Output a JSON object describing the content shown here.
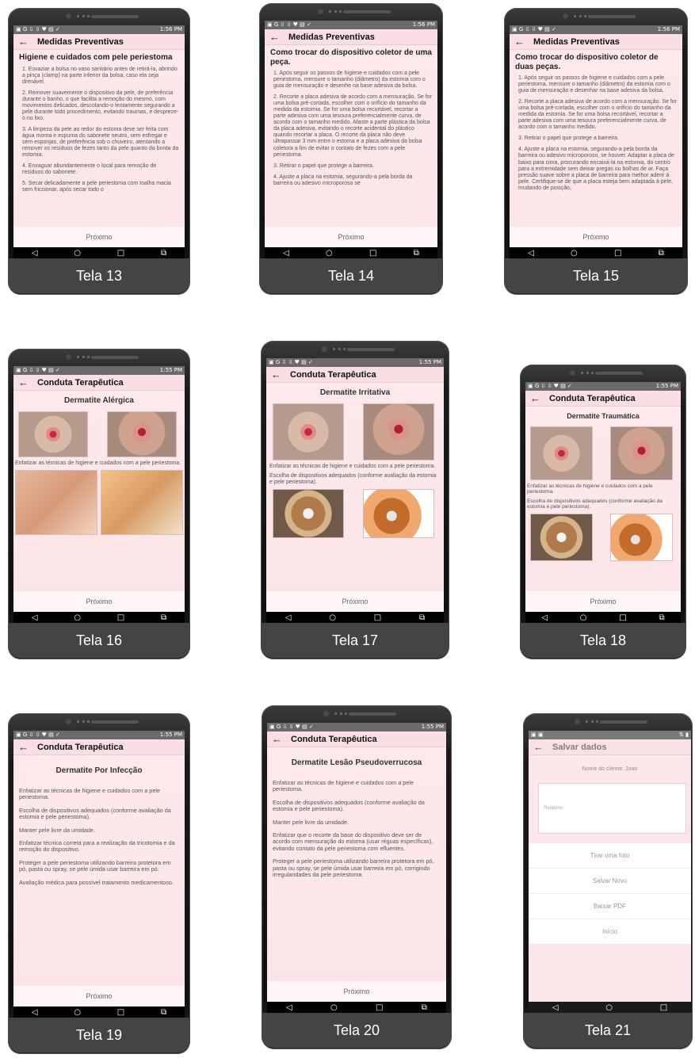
{
  "status": {
    "time": "1:56 PM"
  },
  "status_b": {
    "time": "1:55 PM"
  },
  "common": {
    "back_arrow": "←",
    "next_label": "Próximo",
    "nav_back": "◁",
    "nav_home": "○",
    "nav_recent": "□",
    "nav_dual": "⧉"
  },
  "icons": [
    "back-arrow-icon",
    "nav-back-icon",
    "nav-home-icon",
    "nav-recent-icon",
    "dual-window-icon"
  ],
  "screens": [
    {
      "tela_label": "Tela 13",
      "title": "Medidas Preventivas",
      "heading": "Higiene e cuidados com pele periestoma",
      "paragraphs": [
        "1. Esvaziar a bolsa no vaso sanitário antes de retirá-la, abrindo a pinça (clamp) na parte inferior da bolsa, caso ela seja drenável.",
        "2. Remover suavemente o dispositivo da pele, de preferência durante o banho, o que facilita a remoção do mesmo, com movimentos delicados, descolando-o lentamente segurando a pele durante todo procedimento, evitando traumas, e despreze-o no lixo.",
        "3. A limpeza da pele ao redor do estoma deve ser feita com água morna e espuma do sabonete neutro, sem esfregar e sem esponjas, de preferência sob o chuveiro, atentando a remover os resíduos de fezes tanto da pele quanto da borda da estomia.",
        "4. Enxaguar abundantemente o local para remoção de resíduos do sabonete.",
        "5. Secar delicadamente a pele periestoma com toalha macia sem friccionar, após secar todo o"
      ]
    },
    {
      "tela_label": "Tela 14",
      "title": "Medidas Preventivas",
      "heading": "Como trocar do dispositivo coletor de uma peça.",
      "paragraphs": [
        "1. Após seguir os passos de higiene e cuidados com a pele periestoma, mensure o tamanho (diâmetro) da estomia com o guia de mensuração e desenhe na base adesiva da bolsa.",
        "2. Recorte a placa adesiva de acordo com a mensuração. Se for uma bolsa pré-cortada, escolher com o orifício do tamanho da medida da estomia. Se for uma bolsa recortável, recortar a parte adesiva com uma tesoura preferencialmente curva, de acordo com o tamanho medido. Afaste a parte plástica da bolsa da placa adesiva, evitando o recorte acidental do plástico quando recortar a placa. O recorte da placa não deve ultrapassar 3 mm entre o estoma e a placa adesiva da bolsa coletora a fim de evitar o contato de fezes com a pele periestoma.",
        "3. Retirar o papel que protege a barreira.",
        "4. Ajuste a placa na estomia, segurando-a pela borda da barreira ou adesivo microporoso se"
      ]
    },
    {
      "tela_label": "Tela 15",
      "title": "Medidas Preventivas",
      "heading": "Como trocar do dispositivo coletor de duas peças.",
      "paragraphs": [
        "1. Após seguir os passos de higiene e cuidados com a pele periestoma, mensure o tamanho (diâmetro) da estomia com o guia de mensuração e desenhar na base adesiva da bolsa.",
        "2. Recorte a placa adesiva de acordo com a mensuração. Se for uma bolsa pré-cortada, escolher com o orifício do tamanho da medida da estomia. Se for uma bolsa recortável, recortar a parte adesiva com uma tesoura preferencialmente curva, de acordo com o tamanho medido.",
        "3. Retirar o papel que protege a barreira.",
        "4. Ajuste a placa na estomia, segurando-a pela borda da barreira ou adesivo microporoso, se houver. Adaptar a placa de baixo para cima, procurando encaixá-la na estomia, do centro para a extremidade sem deixar pregas ou bolhas de ar. Faça pressão suave sobre a placa de barreira para melhor aderir à pele. Certifique-se de que a placa esteja bem adaptada à pele, mudando de posição,"
      ]
    },
    {
      "tela_label": "Tela 16",
      "title": "Conduta Terapêutica",
      "subheading": "Dermatite Alérgica",
      "paragraphs": [
        "Enfatizar as técnicas de higiene e cuidados com a pele periestoma."
      ]
    },
    {
      "tela_label": "Tela 17",
      "title": "Conduta Terapêutica",
      "subheading": "Dermatite Irritativa",
      "paragraphs": [
        "Enfatizar as técnicas de higiene e cuidados com a pele periestoma.",
        "Escolha de dispositivos adequados (conforme avaliação da estomia e pele periestoma)."
      ]
    },
    {
      "tela_label": "Tela 18",
      "title": "Conduta Terapêutica",
      "subheading": "Dermatite Traumática",
      "paragraphs": [
        "Enfatizar as técnicas de higiene e cuidados com a pele periestoma.",
        "Escolha de dispositivos adequados (conforme avaliação da estomia e pele periestoma)."
      ]
    },
    {
      "tela_label": "Tela 19",
      "title": "Conduta Terapêutica",
      "subheading": "Dermatite Por Infecção",
      "paragraphs": [
        "Enfatizar as técnicas de higiene e cuidados com a pele periestoma.",
        "Escolha de dispositivos adequados (conforme avaliação da estomia e pele periestoma).",
        "Manter pele livre da umidade.",
        "Enfatizar técnica correta para a realização da tricotomia e da remoção do dispositivo.",
        "Proteger a pele periestoma utilizando barreira protetora em pó, pasta ou spray, se pele úmida usar barreira em pó.",
        "Avaliação médica para possível tratamento medicamentoso."
      ]
    },
    {
      "tela_label": "Tela 20",
      "title": "Conduta Terapêutica",
      "subheading": "Dermatite Lesão Pseudoverrucosa",
      "paragraphs": [
        "Enfatizar as técnicas de higiene e cuidados com a pele periestoma.",
        "Escolha de dispositivos adequados (conforme avaliação da estomia e pele periestoma).",
        "Manter pele livre da umidade.",
        "Enfatizar que o recorte da base do dispositivo deve ser de acordo com mensuração do estoma (usar réguas específicas), evitando contato da pele periestoma com efluentes.",
        "Proteger a pele periestoma utilizando barreira protetora em pó, pasta ou spray, se pele úmida usar barreira em pó, corrigindo irregularidades da pele periestoma."
      ]
    },
    {
      "tela_label": "Tela 21",
      "title": "Salvar dados",
      "form_label": "Nome do cliente: Joao",
      "form_box": "Relatório",
      "buttons": [
        "Tirar uma foto",
        "Salvar Novo",
        "Baixar PDF",
        "Início"
      ]
    }
  ]
}
